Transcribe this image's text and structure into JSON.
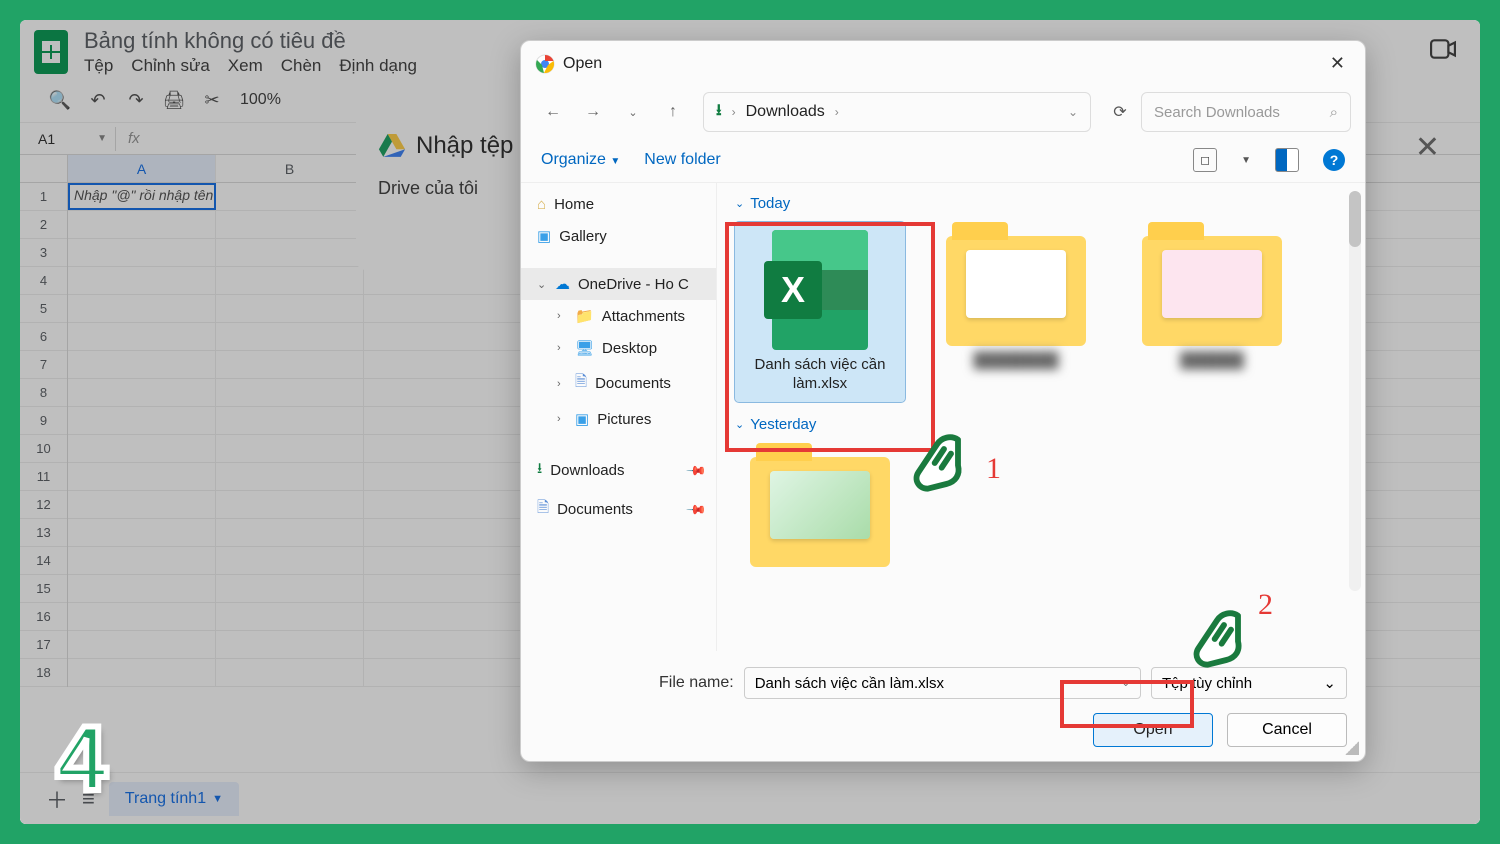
{
  "sheets": {
    "doc_title": "Bảng tính không có tiêu đề",
    "menus": [
      "Tệp",
      "Chỉnh sửa",
      "Xem",
      "Chèn",
      "Định dạng"
    ],
    "zoom": "100%",
    "cell_ref": "A1",
    "fx_label": "fx",
    "placeholder_cell": "Nhập \"@\" rồi nhập tên tệp để chèn",
    "columns": [
      "A",
      "B"
    ],
    "rows": [
      "1",
      "2",
      "3",
      "4",
      "5",
      "6",
      "7",
      "8",
      "9",
      "10",
      "11",
      "12",
      "13",
      "14",
      "15",
      "16",
      "17",
      "18"
    ],
    "sheet_tab": "Trang tính1"
  },
  "import": {
    "title": "Nhập tệp",
    "tab": "Drive của tôi"
  },
  "dialog": {
    "title": "Open",
    "nav": {
      "path_root": "Downloads"
    },
    "search_placeholder": "Search Downloads",
    "toolbar": {
      "organize": "Organize",
      "new_folder": "New folder"
    },
    "tree": {
      "home": "Home",
      "gallery": "Gallery",
      "onedrive": "OneDrive - Ho C",
      "attachments": "Attachments",
      "desktop": "Desktop",
      "documents": "Documents",
      "pictures": "Pictures",
      "downloads": "Downloads",
      "documents2": "Documents"
    },
    "groups": {
      "today": "Today",
      "yesterday": "Yesterday"
    },
    "files": {
      "selected_name": "Danh sách việc cần làm.xlsx"
    },
    "footer": {
      "filename_label": "File name:",
      "filename_value": "Danh sách việc cần làm.xlsx",
      "filter": "Tệp tùy chỉnh",
      "open": "Open",
      "cancel": "Cancel"
    }
  },
  "annotations": {
    "n1": "1",
    "n2": "2",
    "badge": "4"
  }
}
